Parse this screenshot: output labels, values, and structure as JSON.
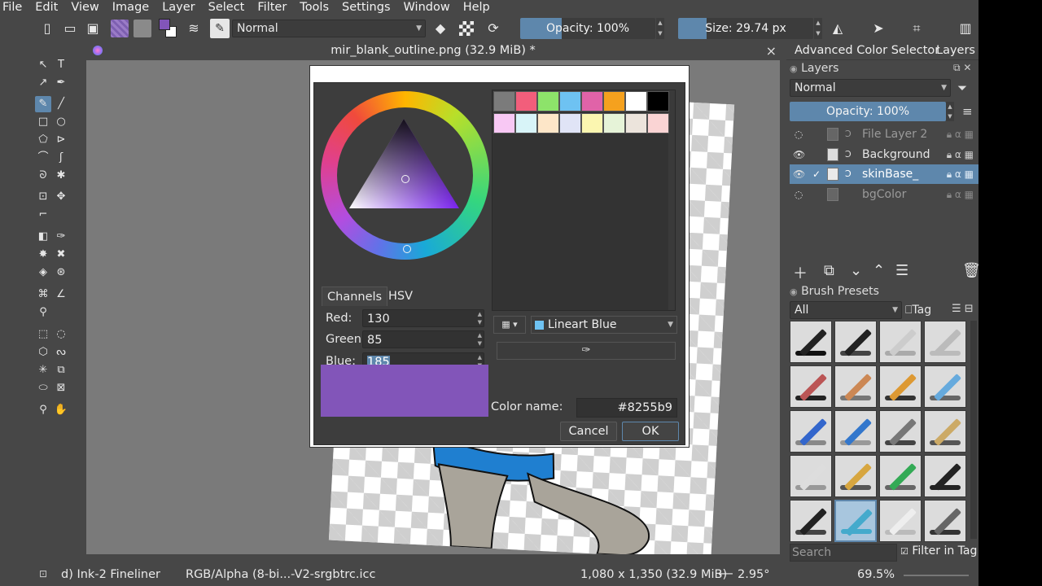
{
  "menu": [
    "File",
    "Edit",
    "View",
    "Image",
    "Layer",
    "Select",
    "Filter",
    "Tools",
    "Settings",
    "Window",
    "Help"
  ],
  "toolbar": {
    "blend_mode": "Normal",
    "opacity_label": "Opacity: 100%",
    "opacity_fraction": 0.31,
    "size_label": "Size: 29.74 px",
    "size_fraction": 0.21,
    "fg_color": "#8255b9",
    "bg_color": "#ffffff"
  },
  "document": {
    "tab_title": "mir_blank_outline.png (32.9 MiB) *"
  },
  "dock": {
    "tabs": [
      "Advanced Color Selector",
      "Layers"
    ],
    "layers_title": "Layers",
    "blend_mode": "Normal",
    "opacity_label": "Opacity:  100%",
    "layers": [
      {
        "name": "File Layer 2",
        "visible": false,
        "selected": false
      },
      {
        "name": "Background",
        "visible": true,
        "selected": false
      },
      {
        "name": "skinBase_",
        "visible": true,
        "selected": true
      },
      {
        "name": "bgColor",
        "visible": false,
        "selected": false
      }
    ],
    "brush_presets_title": "Brush Presets",
    "tag_filter": "All",
    "tag_button": "Tag",
    "search_placeholder": "Search",
    "filter_in_tag": "Filter in Tag"
  },
  "dialog": {
    "tabs": [
      "Channels",
      "HSV"
    ],
    "red_label": "Red:",
    "red_value": "130",
    "green_label": "Green:",
    "green_value": "85",
    "blue_label": "Blue:",
    "blue_value": "185",
    "palette_name": "Lineart Blue",
    "color_name_label": "Color name:",
    "color_name_value": "#8255b9",
    "cancel_label": "Cancel",
    "ok_label": "OK",
    "palette_row1": [
      "#7b7b7b",
      "#f25e7b",
      "#8de36a",
      "#6ec2f2",
      "#e063a8",
      "#f5a11e",
      "#ffffff",
      "#000000"
    ],
    "palette_row2": [
      "#f8c8f4",
      "#d8f4f8",
      "#fde6c8",
      "#e0e4f6",
      "#fbf6b0",
      "#e6f3d8",
      "#ece4dc",
      "#fad4d4"
    ]
  },
  "status": {
    "brush_name": "d) Ink-2 Fineliner",
    "color_profile": "RGB/Alpha (8-bi...-V2-srgbtrc.icc",
    "image_size": "1,080 x 1,350 (32.9 MiB)",
    "rotation": "2.95°",
    "zoom": "69.5%"
  }
}
